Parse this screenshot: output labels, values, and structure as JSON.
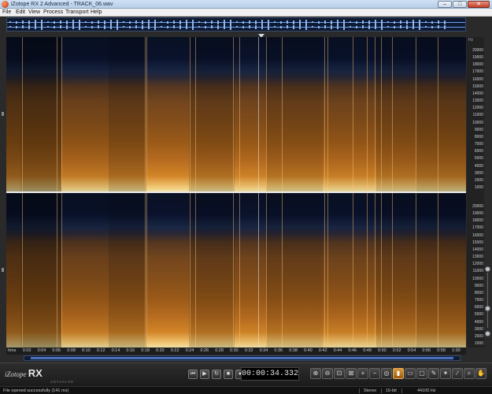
{
  "window": {
    "title": "iZotope RX 2 Advanced - TRACK_06.wav",
    "minimize": "–",
    "maximize": "□",
    "close": "✕"
  },
  "menu": [
    "File",
    "Edit",
    "View",
    "Process",
    "Transport",
    "Help"
  ],
  "frequency_axis": {
    "unit": "Hz",
    "channel1": [
      "20000",
      "19000",
      "18000",
      "17000",
      "16000",
      "15000",
      "14000",
      "13000",
      "12000",
      "11000",
      "10000",
      "9000",
      "8000",
      "7000",
      "6000",
      "5000",
      "4000",
      "3000",
      "2000",
      "1000"
    ],
    "channel2": [
      "20000",
      "19000",
      "18000",
      "17000",
      "16000",
      "15000",
      "14000",
      "13000",
      "12000",
      "11000",
      "10000",
      "9000",
      "8000",
      "7000",
      "6000",
      "5000",
      "4000",
      "3000",
      "2000",
      "1000"
    ]
  },
  "time_axis": {
    "labels": [
      "hms",
      "0:02",
      "0:04",
      "0:06",
      "0:08",
      "0:10",
      "0:12",
      "0:14",
      "0:16",
      "0:18",
      "0:20",
      "0:22",
      "0:24",
      "0:26",
      "0:28",
      "0:30",
      "0:32",
      "0:34",
      "0:36",
      "0:38",
      "0:40",
      "0:42",
      "0:44",
      "0:46",
      "0:48",
      "0:50",
      "0:52",
      "0:54",
      "0:56",
      "0:58",
      "1:00"
    ]
  },
  "transport": {
    "timecode": "00:00:34.332",
    "buttons": [
      {
        "name": "go-to-start-button",
        "glyph": "⏮"
      },
      {
        "name": "play-button",
        "glyph": "▶"
      },
      {
        "name": "loop-play-button",
        "glyph": "↻"
      },
      {
        "name": "stop-button",
        "glyph": "■"
      },
      {
        "name": "record-button",
        "glyph": "●"
      }
    ]
  },
  "toolbar": {
    "tools": [
      {
        "name": "zoom-in-icon",
        "glyph": "⊕"
      },
      {
        "name": "zoom-out-icon",
        "glyph": "⊖"
      },
      {
        "name": "zoom-selection-icon",
        "glyph": "⊡"
      },
      {
        "name": "zoom-fit-icon",
        "glyph": "⊠"
      },
      {
        "name": "zoom-time-in-icon",
        "glyph": "+"
      },
      {
        "name": "zoom-time-out-icon",
        "glyph": "−"
      },
      {
        "name": "zoom-reset-icon",
        "glyph": "◎"
      },
      {
        "name": "time-select-icon",
        "glyph": "▮",
        "active": true
      },
      {
        "name": "freq-select-icon",
        "glyph": "▭"
      },
      {
        "name": "rect-select-icon",
        "glyph": "▢"
      },
      {
        "name": "lasso-icon",
        "glyph": "✎"
      },
      {
        "name": "magic-wand-icon",
        "glyph": "✦"
      },
      {
        "name": "brush-icon",
        "glyph": "∕"
      },
      {
        "name": "zoom-tool-icon",
        "glyph": "⌕"
      },
      {
        "name": "hand-icon",
        "glyph": "✋"
      }
    ]
  },
  "status": {
    "message": "File opened successfully (141 ms)",
    "channels": "Stereo",
    "bit_depth": "16-bit",
    "sample_rate": "44100 Hz"
  },
  "logo": {
    "brand": "iZotope",
    "product": "RX",
    "version": "2",
    "edition": "ADVANCED"
  },
  "colors": {
    "spectrogram_hot": "#ffd27a",
    "spectrogram_mid": "#a35f1a",
    "spectrogram_cold": "#0a1226",
    "active_tool": "#d99a3a"
  }
}
